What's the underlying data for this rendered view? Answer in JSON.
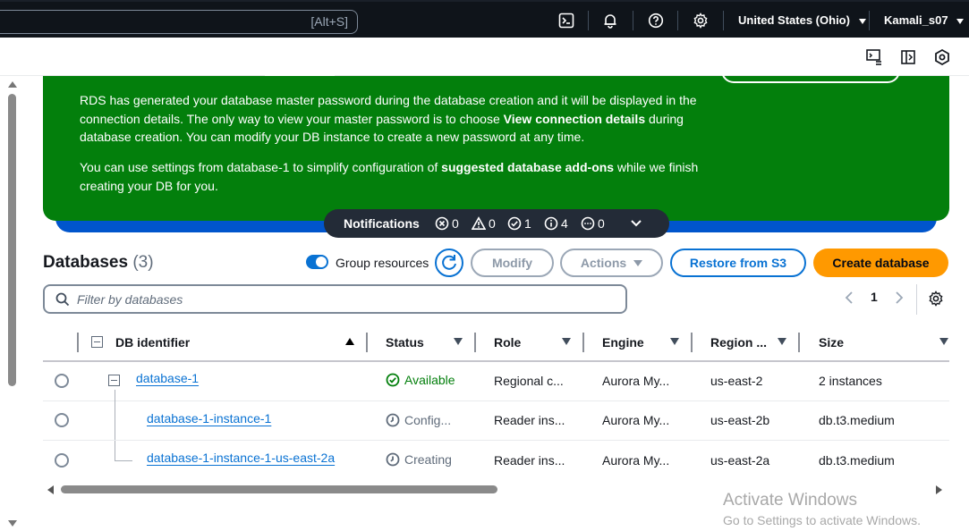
{
  "topbar": {
    "search_shortcut": "[Alt+S]",
    "region": "United States (Ohio)",
    "user": "Kamali_s07",
    "icons": [
      "cloudshell-icon",
      "bell-icon",
      "help-icon",
      "settings-icon"
    ]
  },
  "flash": {
    "para1_a": "RDS has generated your database master password during the database creation and it will be displayed in the connection details. The only way to view your master password is to choose ",
    "para1_bold": "View connection details",
    "para1_b": " during database creation. You can modify your DB instance to create a new password at any time.",
    "para2_a": "You can use settings from database-1 to simplify configuration of ",
    "para2_bold": "suggested database add-ons",
    "para2_b": " while we finish creating your DB for you.",
    "color": "#037f0c"
  },
  "notifications": {
    "title": "Notifications",
    "errors": "0",
    "warnings": "0",
    "success": "1",
    "info": "4",
    "in_progress": "0"
  },
  "databases": {
    "title": "Databases",
    "count": "(3)",
    "group_resources_label": "Group resources",
    "modify_label": "Modify",
    "actions_label": "Actions",
    "restore_label": "Restore from S3",
    "create_label": "Create database",
    "filter_placeholder": "Filter by databases",
    "page": "1"
  },
  "table": {
    "headers": {
      "id": "DB identifier",
      "status": "Status",
      "role": "Role",
      "engine": "Engine",
      "region": "Region ...",
      "size": "Size"
    },
    "rows": [
      {
        "id": "database-1",
        "status": "Available",
        "role": "Regional c...",
        "engine": "Aurora My...",
        "region": "us-east-2",
        "size": "2 instances"
      },
      {
        "id": "database-1-instance-1",
        "status": "Config...",
        "role": "Reader ins...",
        "engine": "Aurora My...",
        "region": "us-east-2b",
        "size": "db.t3.medium"
      },
      {
        "id": "database-1-instance-1-us-east-2a",
        "status": "Creating",
        "role": "Reader ins...",
        "engine": "Aurora My...",
        "region": "us-east-2a",
        "size": "db.t3.medium"
      }
    ]
  },
  "watermark": {
    "line1": "Activate Windows",
    "line2": "Go to Settings to activate Windows."
  }
}
